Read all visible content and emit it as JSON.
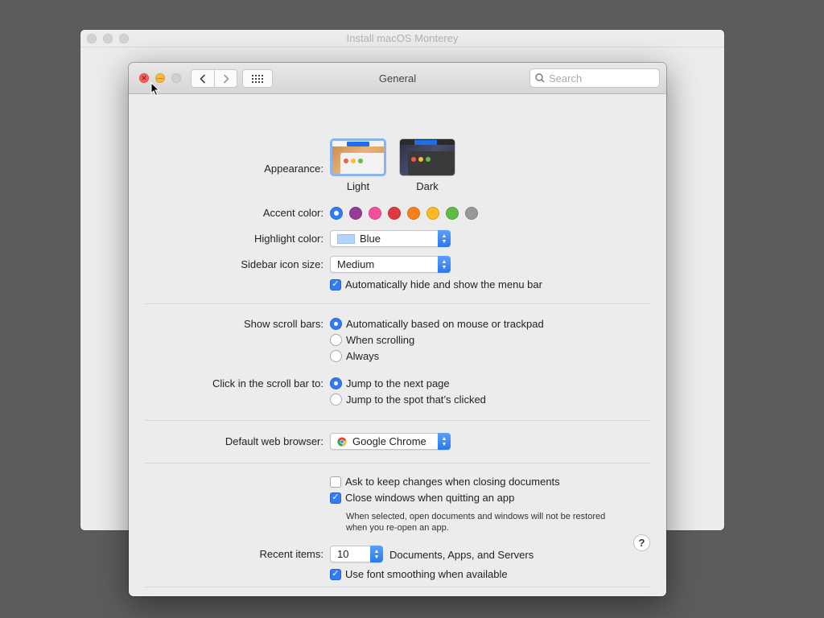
{
  "background_window": {
    "title": "Install macOS Monterey"
  },
  "window": {
    "title": "General"
  },
  "search": {
    "placeholder": "Search"
  },
  "appearance": {
    "label": "Appearance:",
    "options": [
      {
        "label": "Light",
        "selected": true
      },
      {
        "label": "Dark",
        "selected": false
      }
    ]
  },
  "accent": {
    "label": "Accent color:",
    "colors": [
      "#2f7cf6",
      "#953d96",
      "#f74f9e",
      "#e0383e",
      "#f7821b",
      "#fcb827",
      "#62ba46",
      "#989898"
    ],
    "selected_index": 0
  },
  "highlight": {
    "label": "Highlight color:",
    "value": "Blue"
  },
  "sidebar_icon": {
    "label": "Sidebar icon size:",
    "value": "Medium"
  },
  "menu_bar": {
    "label": "Automatically hide and show the menu bar",
    "checked": true
  },
  "scroll_bars": {
    "label": "Show scroll bars:",
    "options": [
      {
        "label": "Automatically based on mouse or trackpad",
        "selected": true
      },
      {
        "label": "When scrolling",
        "selected": false
      },
      {
        "label": "Always",
        "selected": false
      }
    ]
  },
  "click_scroll": {
    "label": "Click in the scroll bar to:",
    "options": [
      {
        "label": "Jump to the next page",
        "selected": true
      },
      {
        "label": "Jump to the spot that’s clicked",
        "selected": false
      }
    ]
  },
  "browser": {
    "label": "Default web browser:",
    "value": "Google Chrome"
  },
  "documents": {
    "ask_keep": {
      "label": "Ask to keep changes when closing documents",
      "checked": false
    },
    "close_windows": {
      "label": "Close windows when quitting an app",
      "checked": true
    },
    "note_line1": "When selected, open documents and windows will not be restored",
    "note_line2": "when you re-open an app."
  },
  "recent": {
    "label": "Recent items:",
    "value": "10",
    "suffix": "Documents, Apps, and Servers"
  },
  "font_smoothing": {
    "label": "Use font smoothing when available",
    "checked": true
  },
  "help": {
    "label": "?"
  }
}
